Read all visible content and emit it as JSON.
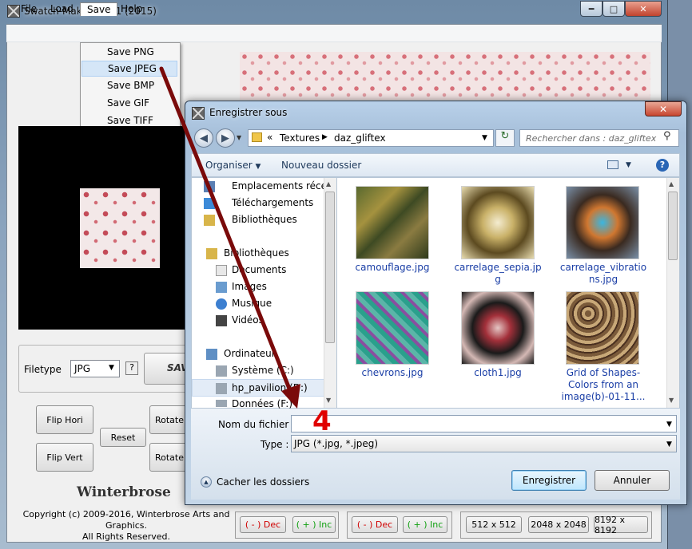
{
  "main": {
    "title": "Swatch-Maker v3.11 (2015)",
    "menu": [
      "File",
      "Load",
      "Save",
      "Help"
    ],
    "save_menu": [
      "Save PNG",
      "Save JPEG",
      "Save BMP",
      "Save GIF",
      "Save TIFF"
    ],
    "filetype_label": "Filetype",
    "filetype_value": "JPG",
    "help_label": "?",
    "save_button": "SAV",
    "flip_hori": "Flip Hori",
    "flip_vert": "Flip Vert",
    "reset": "Reset",
    "rotate": "Rotate",
    "logo": "Winterbrose",
    "copyright_1": "Copyright (c) 2009-2016, Winterbrose Arts and Graphics.",
    "copyright_2": "All Rights Reserved.",
    "dec_label": "( - ) Dec",
    "inc_label": "( + ) Inc",
    "sizes": [
      "512 x 512",
      "2048 x 2048",
      "8192 x 8192"
    ]
  },
  "dialog": {
    "title": "Enregistrer sous",
    "breadcrumb": [
      "Textures",
      "daz_gliftex"
    ],
    "search_placeholder": "Rechercher dans : daz_gliftex",
    "toolbar": {
      "organize": "Organiser",
      "new_folder": "Nouveau dossier"
    },
    "nav": [
      "Emplacements récents",
      "Téléchargements",
      "Bibliothèques",
      "Bibliothèques",
      "Documents",
      "Images",
      "Musique",
      "Vidéos",
      "Ordinateur",
      "Système (C:)",
      "hp_pavilion (D:)",
      "Données (F:)"
    ],
    "files": [
      {
        "name": "camouflage.jpg"
      },
      {
        "name": "carrelage_sepia.jpg"
      },
      {
        "name": "carrelage_vibrations.jpg"
      },
      {
        "name": "chevrons.jpg"
      },
      {
        "name": "cloth1.jpg"
      },
      {
        "name": "Grid of Shapes-Colors from an image(b)-01-11..."
      }
    ],
    "filename_label": "Nom du fichier :",
    "filename_value": "",
    "type_label": "Type :",
    "type_value": "JPG (*.jpg, *.jpeg)",
    "hide_folders": "Cacher les dossiers",
    "save_button": "Enregistrer",
    "cancel_button": "Annuler"
  },
  "annotation": {
    "step": "4",
    "color": "#7a0a0a"
  }
}
